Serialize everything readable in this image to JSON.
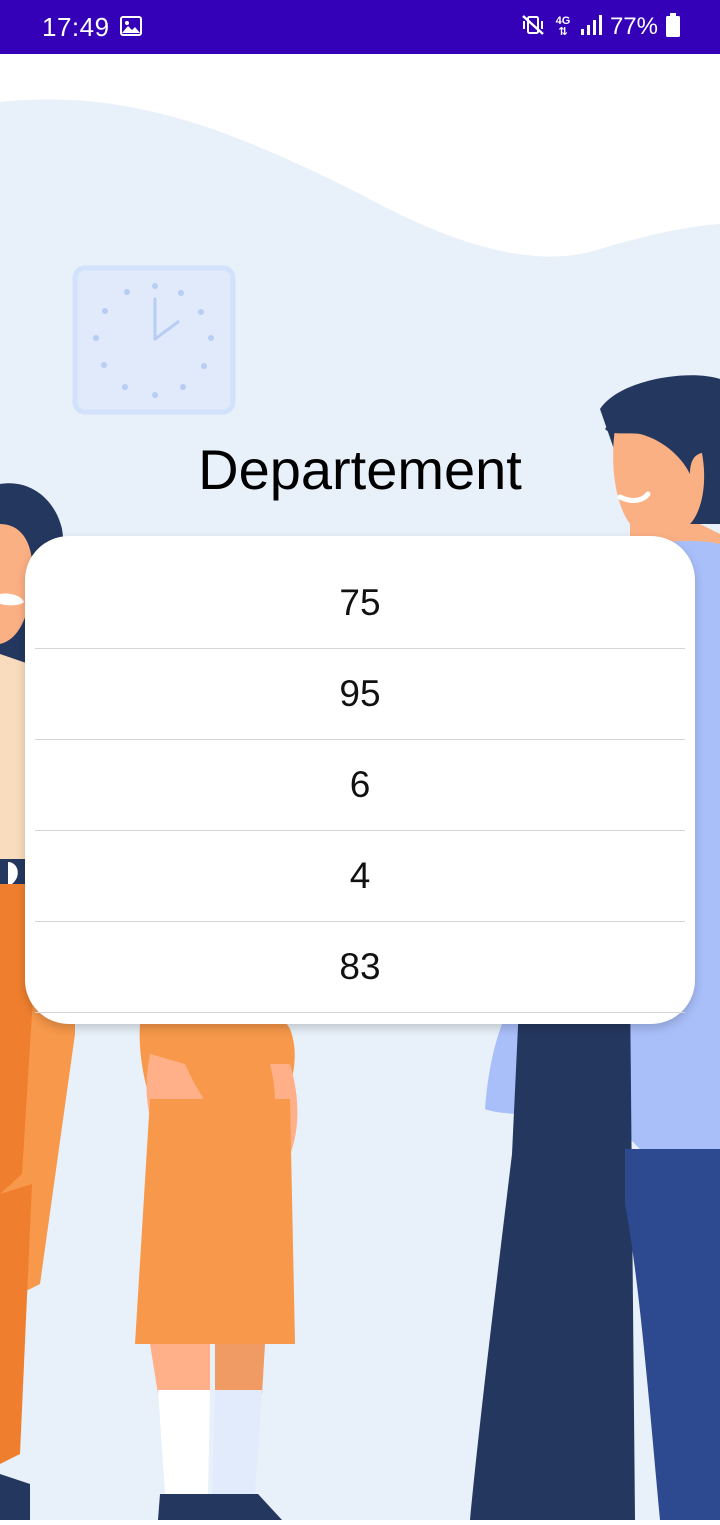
{
  "status_bar": {
    "time": "17:49",
    "network_label": "4G",
    "battery_text": "77%",
    "background_color": "#3400b8",
    "icons": [
      "gallery-icon",
      "vibrate-muted-icon",
      "network-4g-icon",
      "signal-icon",
      "battery-icon"
    ]
  },
  "page": {
    "title": "Departement"
  },
  "list": {
    "items": [
      {
        "label": "75"
      },
      {
        "label": "95"
      },
      {
        "label": "6"
      },
      {
        "label": "4"
      },
      {
        "label": "83"
      }
    ]
  },
  "colors": {
    "background_tint": "#e8f0f9",
    "clock": "#d2e2fa",
    "man_hair": "#24375f",
    "man_skin": "#fbb084",
    "man_shirt": "#a9bffa",
    "man_pants": "#24375f",
    "girl_dress": "#f7984a",
    "woman_pants": "#ef7f2e"
  }
}
